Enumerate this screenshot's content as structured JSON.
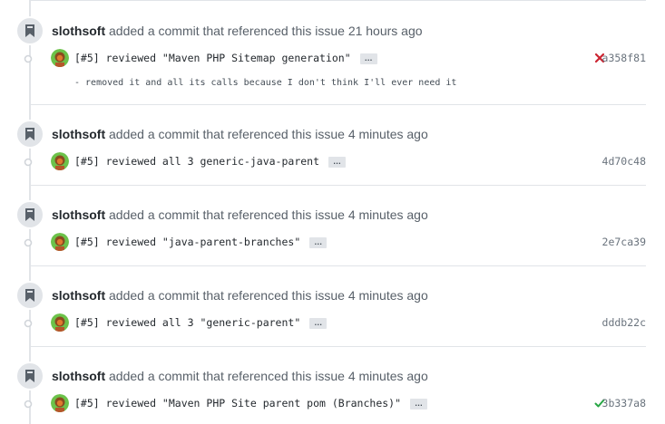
{
  "events": [
    {
      "author": "slothsoft",
      "action": "added a commit that referenced this issue",
      "time": "21 hours ago",
      "commit": {
        "message": "[#5] reviewed \"Maven PHP Sitemap generation\"",
        "ellipsis": "…",
        "sha": "a358f81",
        "status": "failure",
        "description": "- removed it and all its calls because I don't think I'll ever need it"
      }
    },
    {
      "author": "slothsoft",
      "action": "added a commit that referenced this issue",
      "time": "4 minutes ago",
      "commit": {
        "message": "[#5] reviewed all 3 generic-java-parent",
        "ellipsis": "…",
        "sha": "4d70c48",
        "status": "none"
      }
    },
    {
      "author": "slothsoft",
      "action": "added a commit that referenced this issue",
      "time": "4 minutes ago",
      "commit": {
        "message": "[#5] reviewed \"java-parent-branches\"",
        "ellipsis": "…",
        "sha": "2e7ca39",
        "status": "none"
      }
    },
    {
      "author": "slothsoft",
      "action": "added a commit that referenced this issue",
      "time": "4 minutes ago",
      "commit": {
        "message": "[#5] reviewed all 3 \"generic-parent\"",
        "ellipsis": "…",
        "sha": "dddb22c",
        "status": "none"
      }
    },
    {
      "author": "slothsoft",
      "action": "added a commit that referenced this issue",
      "time": "4 minutes ago",
      "commit": {
        "message": "[#5] reviewed \"Maven PHP Site parent pom (Branches)\"",
        "ellipsis": "…",
        "sha": "3b337a8",
        "status": "success"
      }
    }
  ],
  "colors": {
    "failure": "#cb2431",
    "success": "#28a745",
    "badge": "#e1e4e8",
    "line": "#e1e4e8"
  },
  "icons": {
    "badge": "bookmark-icon",
    "commit_node": "git-commit-icon",
    "failure": "x-icon",
    "success": "check-icon"
  }
}
